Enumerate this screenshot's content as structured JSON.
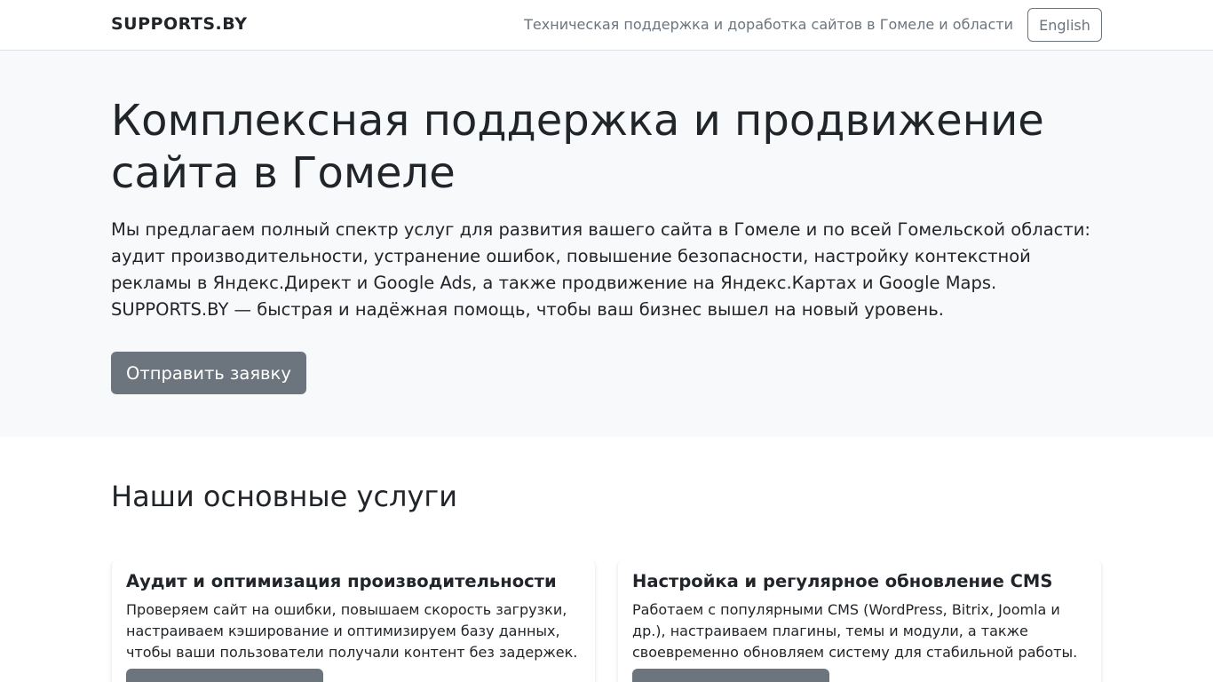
{
  "navbar": {
    "brand": "SUPPORTS.BY",
    "tagline": "Техническая поддержка и доработка сайтов в Гомеле и области",
    "language_button": "English"
  },
  "hero": {
    "title": "Комплексная поддержка и продвижение сайта в Гомеле",
    "lead": "Мы предлагаем полный спектр услуг для развития вашего сайта в Гомеле и по всей Гомельской области: аудит производительности, устранение ошибок, повышение безопасности, настройку контекстной рекламы в Яндекс.Директ и Google Ads, а также продвижение на Яндекс.Картах и Google Maps. SUPPORTS.BY — быстрая и надёжная помощь, чтобы ваш бизнес вышел на новый уровень.",
    "cta_label": "Отправить заявку"
  },
  "services": {
    "title": "Наши основные услуги",
    "cards": [
      {
        "title": "Аудит и оптимизация производительности",
        "text": "Проверяем сайт на ошибки, повышаем скорость загрузки, настраиваем кэширование и оптимизируем базу данных, чтобы ваши пользователи получали контент без задержек."
      },
      {
        "title": "Настройка и регулярное обновление CMS",
        "text": "Работаем с популярными CMS (WordPress, Bitrix, Joomla и др.), настраиваем плагины, темы и модули, а также своевременно обновляем систему для стабильной работы."
      }
    ]
  },
  "colors": {
    "hero_background": "#f8f9fa",
    "button_secondary": "#6c757d",
    "text_primary": "#212529",
    "text_muted": "#6c757d",
    "border": "#dee2e6"
  }
}
